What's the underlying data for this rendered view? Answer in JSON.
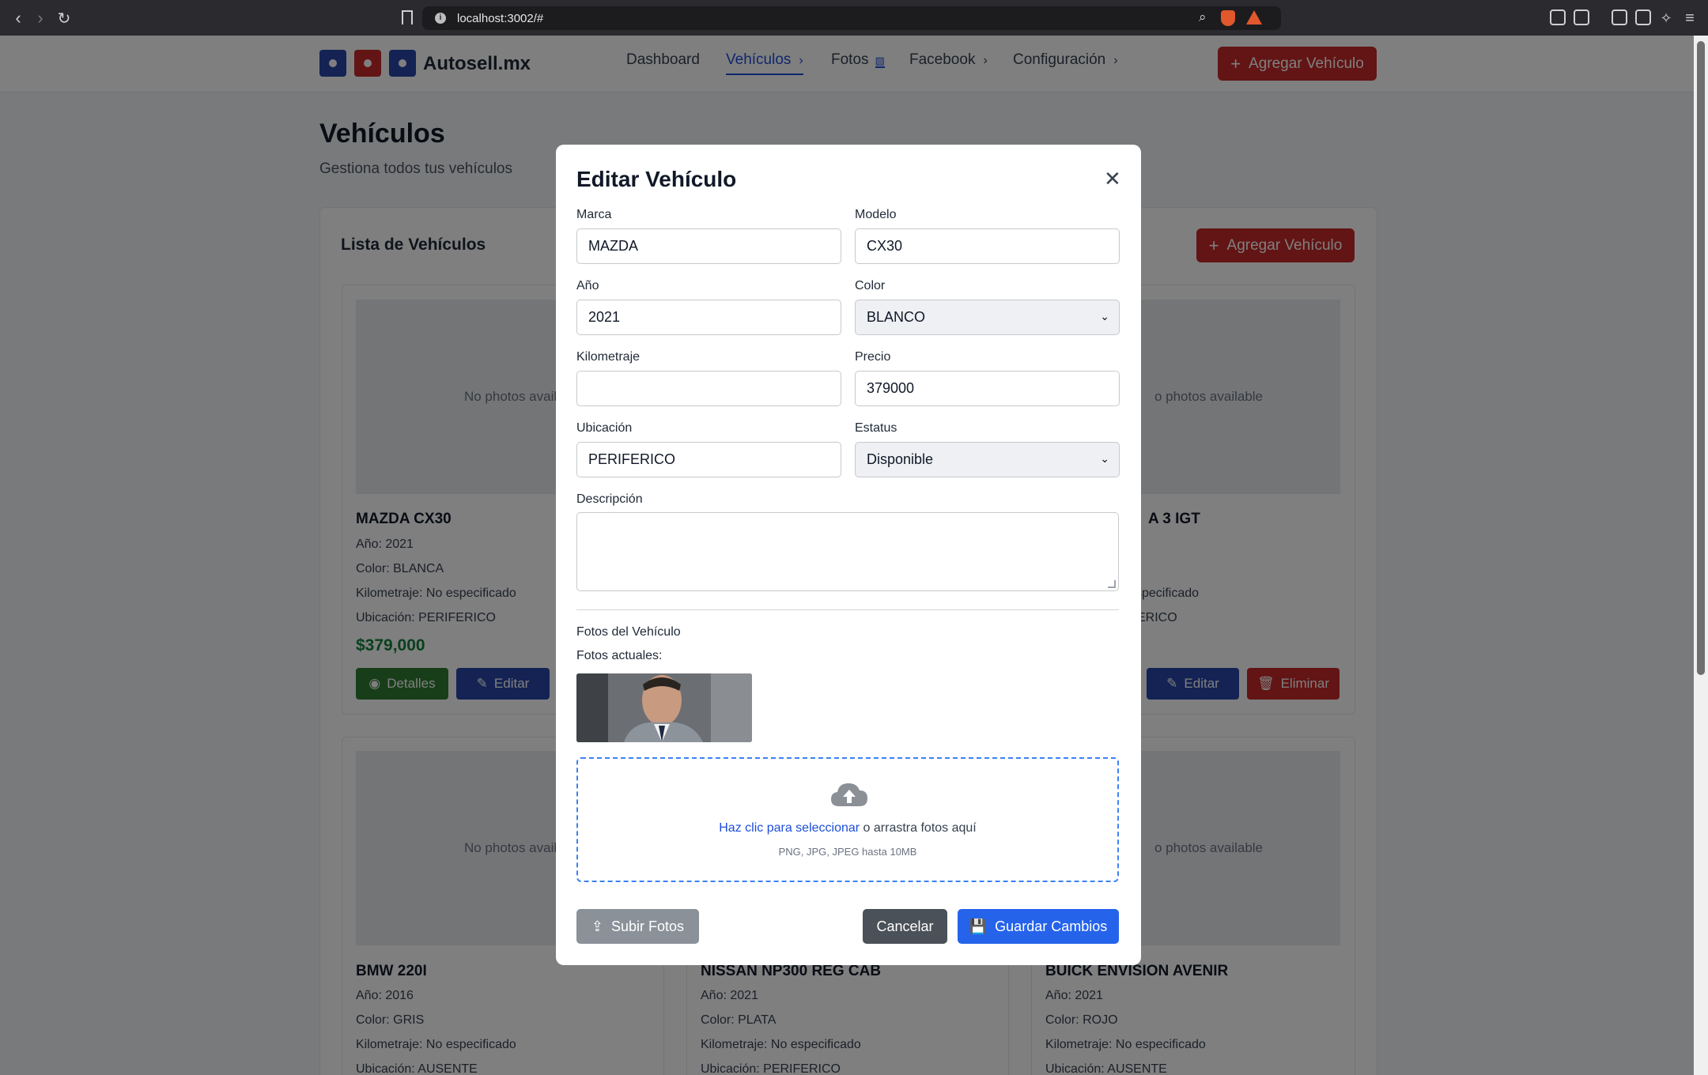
{
  "browser": {
    "url": "localhost:3002/#"
  },
  "navbar": {
    "brand": "Autosell.mx",
    "links": [
      {
        "label": "Dashboard"
      },
      {
        "label": "Vehículos"
      },
      {
        "label": "Fotos"
      },
      {
        "label": "Facebook"
      },
      {
        "label": "Configuración"
      }
    ],
    "add_button": "Agregar Vehículo",
    "colors": {
      "blue": "#2947a8",
      "red": "#c62828"
    }
  },
  "page": {
    "title": "Vehículos",
    "subtitle": "Gestiona todos tus vehículos",
    "list_title": "Lista de Vehículos",
    "add_button": "Agregar Vehículo",
    "no_photos": "No photos available",
    "no_photos_cut_left": "No photos availab",
    "no_photos_cut_right": "o photos available"
  },
  "cards": {
    "mazda": {
      "name": "MAZDA CX30",
      "year": "Año: 2021",
      "color": "Color: BLANCA",
      "km": "Kilometraje: No especificado",
      "location": "Ubicación: PERIFERICO",
      "price": "$379,000",
      "details_btn": "Detalles",
      "edit_btn": "Editar"
    },
    "right_top": {
      "name_partial": "A 3 IGT",
      "km_partial": "specificado",
      "location_partial": "ERICO",
      "edit_btn": "Editar",
      "delete_btn": "Eliminar"
    },
    "bmw": {
      "name": "BMW 220I",
      "year": "Año: 2016",
      "color": "Color: GRIS",
      "km": "Kilometraje: No especificado",
      "location": "Ubicación: AUSENTE"
    },
    "nissan": {
      "name": "NISSAN NP300 REG CAB",
      "year": "Año: 2021",
      "color": "Color: PLATA",
      "km": "Kilometraje: No especificado",
      "location": "Ubicación: PERIFERICO"
    },
    "buick": {
      "name": "BUICK ENVISION AVENIR",
      "year": "Año: 2021",
      "color": "Color: ROJO",
      "km": "Kilometraje: No especificado",
      "location": "Ubicación: AUSENTE"
    }
  },
  "modal": {
    "title": "Editar Vehículo",
    "fields": {
      "marca": {
        "label": "Marca",
        "value": "MAZDA"
      },
      "modelo": {
        "label": "Modelo",
        "value": "CX30"
      },
      "anio": {
        "label": "Año",
        "value": "2021"
      },
      "color": {
        "label": "Color",
        "value": "BLANCO"
      },
      "kilometraje": {
        "label": "Kilometraje",
        "value": ""
      },
      "precio": {
        "label": "Precio",
        "value": "379000"
      },
      "ubicacion": {
        "label": "Ubicación",
        "value": "PERIFERICO"
      },
      "estatus": {
        "label": "Estatus",
        "value": "Disponible"
      },
      "descripcion": {
        "label": "Descripción",
        "value": ""
      }
    },
    "photos_section": "Fotos del Vehículo",
    "current_photos": "Fotos actuales:",
    "upload": {
      "link": "Haz clic para seleccionar",
      "rest": " o arrastra fotos aquí",
      "hint": "PNG, JPG, JPEG hasta 10MB"
    },
    "buttons": {
      "upload": "Subir Fotos",
      "cancel": "Cancelar",
      "save": "Guardar Cambios"
    }
  }
}
